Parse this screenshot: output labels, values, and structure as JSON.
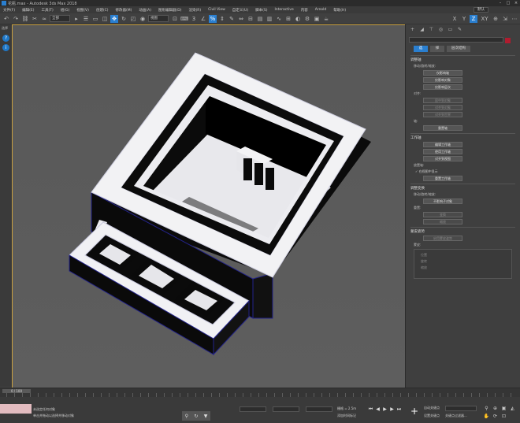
{
  "window": {
    "title": "花瓶.max - Autodesk 3ds Max 2018"
  },
  "menu": {
    "items": [
      "文件(F)",
      "编辑(E)",
      "工具(T)",
      "组(G)",
      "视图(V)",
      "创建(C)",
      "修改器(M)",
      "动画(A)",
      "图形编辑器(D)",
      "渲染(R)",
      "Civil View",
      "自定义(U)",
      "脚本(S)",
      "Interactive",
      "内容",
      "Arnold",
      "帮助(H)"
    ],
    "workspace": "默认"
  },
  "toolbar": {
    "selection_filter": "全部",
    "view_dropdown": "视图",
    "axis_label": "XY"
  },
  "viewport": {
    "label": "[+] [透视] [标准] [边面]"
  },
  "left_panel": {
    "label": "选择"
  },
  "command_panel": {
    "tabs": [
      "选",
      "择",
      "层次结构"
    ],
    "adjust_pivot": {
      "title": "调整轴",
      "move_rotate_scale": "移动/旋转/缩放:",
      "buttons": [
        "仅影响轴",
        "仅影响对象",
        "仅影响层次"
      ]
    },
    "alignment": {
      "title": "对齐:",
      "buttons": [
        "居中到对象",
        "对齐到对象",
        "对齐到世界"
      ]
    },
    "pivot": {
      "title": "轴:",
      "reset_button": "重置轴"
    },
    "working_pivot": {
      "title": "工作轴",
      "buttons": [
        "编辑工作轴",
        "使用工作轴",
        "对齐到视图"
      ],
      "placement": "放置轴:",
      "checkbox": "✓ 在视图中显示",
      "reset_button": "重置工作轴"
    },
    "adjust_transform": {
      "title": "调整变换",
      "move_rotate_scale": "移动/旋转/缩放:",
      "affect_button": "不影响子对象",
      "reset_title": "重置:",
      "reset_buttons": [
        "变换",
        "缩放"
      ]
    },
    "skin_pose": {
      "title": "蒙皮姿势",
      "disabled_button": "启用蒙皮姿势",
      "section": "蒙皮:",
      "items": [
        "位置",
        "旋转",
        "缩放"
      ]
    }
  },
  "timeline": {
    "slider": "0 / 100"
  },
  "status": {
    "line1": "未选定任何对象",
    "line2": "单击并拖动以选择并移动对象",
    "grid": "栅格 = 2.5m",
    "add_time_tag": "添加时间标记",
    "auto_key": "自动关键点",
    "set_key": "设置关键点",
    "key_filters": "关键点过滤器..."
  }
}
